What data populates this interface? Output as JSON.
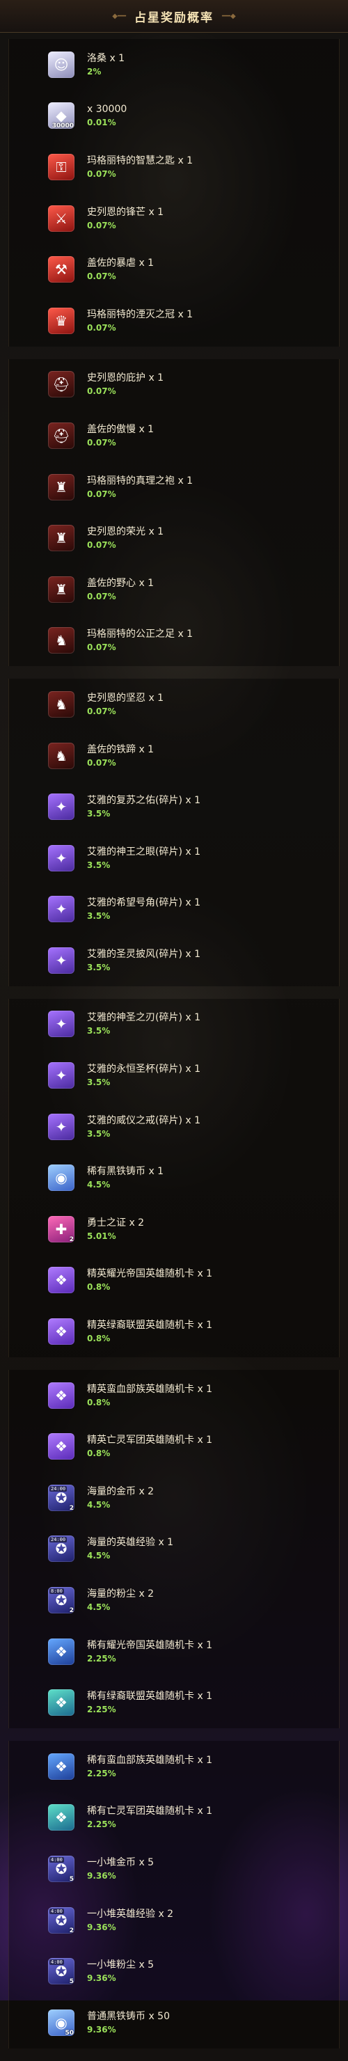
{
  "header": {
    "title": "占星奖励概率"
  },
  "groups": [
    [
      {
        "name": "洛桑 x 1",
        "prob": "2%",
        "icon": "character-icon",
        "style": "i-silver",
        "glyph": "☺"
      },
      {
        "name": "x 30000",
        "prob": "0.01%",
        "icon": "diamond-icon",
        "style": "i-silver",
        "glyph": "◆",
        "badge": "30000"
      },
      {
        "name": "玛格丽特的智慧之匙 x 1",
        "prob": "0.07%",
        "icon": "key-icon",
        "style": "i-red",
        "glyph": "⚿"
      },
      {
        "name": "史列恩的锋芒 x 1",
        "prob": "0.07%",
        "icon": "sword-icon",
        "style": "i-red",
        "glyph": "⚔"
      },
      {
        "name": "盖佐的暴虐 x 1",
        "prob": "0.07%",
        "icon": "weapon-icon",
        "style": "i-red",
        "glyph": "⚒"
      },
      {
        "name": "玛格丽特的湮灭之冠 x 1",
        "prob": "0.07%",
        "icon": "crown-icon",
        "style": "i-red",
        "glyph": "♛"
      }
    ],
    [
      {
        "name": "史列恩的庇护 x 1",
        "prob": "0.07%",
        "icon": "helmet-icon",
        "style": "i-dark",
        "glyph": "⛑"
      },
      {
        "name": "盖佐的傲慢 x 1",
        "prob": "0.07%",
        "icon": "helmet-icon",
        "style": "i-dark",
        "glyph": "⛑"
      },
      {
        "name": "玛格丽特的真理之袍 x 1",
        "prob": "0.07%",
        "icon": "robe-icon",
        "style": "i-dark",
        "glyph": "♜"
      },
      {
        "name": "史列恩的荣光 x 1",
        "prob": "0.07%",
        "icon": "armor-icon",
        "style": "i-dark",
        "glyph": "♜"
      },
      {
        "name": "盖佐的野心 x 1",
        "prob": "0.07%",
        "icon": "armor-icon",
        "style": "i-dark",
        "glyph": "♜"
      },
      {
        "name": "玛格丽特的公正之足 x 1",
        "prob": "0.07%",
        "icon": "boots-icon",
        "style": "i-dark",
        "glyph": "♞"
      }
    ],
    [
      {
        "name": "史列恩的坚忍 x 1",
        "prob": "0.07%",
        "icon": "boots-icon",
        "style": "i-dark",
        "glyph": "♞"
      },
      {
        "name": "盖佐的铁蹄 x 1",
        "prob": "0.07%",
        "icon": "boots-icon",
        "style": "i-dark",
        "glyph": "♞"
      },
      {
        "name": "艾雅的复苏之佑(碎片) x 1",
        "prob": "3.5%",
        "icon": "shard-icon",
        "style": "i-gold",
        "glyph": "✦"
      },
      {
        "name": "艾雅的神王之眼(碎片) x 1",
        "prob": "3.5%",
        "icon": "shard-icon",
        "style": "i-gold",
        "glyph": "✦"
      },
      {
        "name": "艾雅的希望号角(碎片) x 1",
        "prob": "3.5%",
        "icon": "shard-icon",
        "style": "i-gold",
        "glyph": "✦"
      },
      {
        "name": "艾雅的圣灵披风(碎片) x 1",
        "prob": "3.5%",
        "icon": "shard-icon",
        "style": "i-gold",
        "glyph": "✦"
      }
    ],
    [
      {
        "name": "艾雅的神圣之刃(碎片) x 1",
        "prob": "3.5%",
        "icon": "shard-icon",
        "style": "i-gold",
        "glyph": "✦"
      },
      {
        "name": "艾雅的永恒圣杯(碎片) x 1",
        "prob": "3.5%",
        "icon": "shard-icon",
        "style": "i-gold",
        "glyph": "✦"
      },
      {
        "name": "艾雅的威仪之戒(碎片) x 1",
        "prob": "3.5%",
        "icon": "shard-icon",
        "style": "i-gold",
        "glyph": "✦"
      },
      {
        "name": "稀有黑铁铸币 x 1",
        "prob": "4.5%",
        "icon": "coin-icon",
        "style": "i-blue",
        "glyph": "◉"
      },
      {
        "name": "勇士之证 x 2",
        "prob": "5.01%",
        "icon": "badge-icon",
        "style": "i-magenta",
        "glyph": "✚",
        "badge": "2"
      },
      {
        "name": "精英耀光帝国英雄随机卡 x 1",
        "prob": "0.8%",
        "icon": "card-icon",
        "style": "i-violet",
        "glyph": "❖"
      },
      {
        "name": "精英绿裔联盟英雄随机卡 x 1",
        "prob": "0.8%",
        "icon": "card-icon",
        "style": "i-violet",
        "glyph": "❖"
      }
    ],
    [
      {
        "name": "精英蛮血部族英雄随机卡 x 1",
        "prob": "0.8%",
        "icon": "card-icon",
        "style": "i-violet",
        "glyph": "❖"
      },
      {
        "name": "精英亡灵军团英雄随机卡 x 1",
        "prob": "0.8%",
        "icon": "card-icon",
        "style": "i-violet",
        "glyph": "❖"
      },
      {
        "name": "海量的金币 x 2",
        "prob": "4.5%",
        "icon": "gold-coins-icon",
        "style": "i-navy",
        "glyph": "✪",
        "badge": "2",
        "tag": "24:00"
      },
      {
        "name": "海量的英雄经验 x 1",
        "prob": "4.5%",
        "icon": "experience-icon",
        "style": "i-navy",
        "glyph": "✪",
        "tag": "24:00"
      },
      {
        "name": "海量的粉尘 x 2",
        "prob": "4.5%",
        "icon": "dust-icon",
        "style": "i-navy",
        "glyph": "✪",
        "badge": "2",
        "tag": "8:00"
      },
      {
        "name": "稀有耀光帝国英雄随机卡 x 1",
        "prob": "2.25%",
        "icon": "card-icon",
        "style": "i-card-blue",
        "glyph": "❖"
      },
      {
        "name": "稀有绿裔联盟英雄随机卡 x 1",
        "prob": "2.25%",
        "icon": "card-icon",
        "style": "i-card-teal",
        "glyph": "❖"
      }
    ],
    [
      {
        "name": "稀有蛮血部族英雄随机卡 x 1",
        "prob": "2.25%",
        "icon": "card-icon",
        "style": "i-card-blue",
        "glyph": "❖"
      },
      {
        "name": "稀有亡灵军团英雄随机卡 x 1",
        "prob": "2.25%",
        "icon": "card-icon",
        "style": "i-card-teal",
        "glyph": "❖"
      },
      {
        "name": "一小堆金币 x 5",
        "prob": "9.36%",
        "icon": "gold-coins-icon",
        "style": "i-navy",
        "glyph": "✪",
        "badge": "5",
        "tag": "4:00"
      },
      {
        "name": "一小堆英雄经验 x 2",
        "prob": "9.36%",
        "icon": "experience-icon",
        "style": "i-navy",
        "glyph": "✪",
        "badge": "2",
        "tag": "4:00"
      },
      {
        "name": "一小堆粉尘 x 5",
        "prob": "9.36%",
        "icon": "dust-icon",
        "style": "i-navy",
        "glyph": "✪",
        "badge": "5",
        "tag": "4:00"
      },
      {
        "name": "普通黑铁铸币 x 50",
        "prob": "9.36%",
        "icon": "coin-icon",
        "style": "i-blue",
        "glyph": "◉",
        "badge": "50"
      }
    ]
  ]
}
